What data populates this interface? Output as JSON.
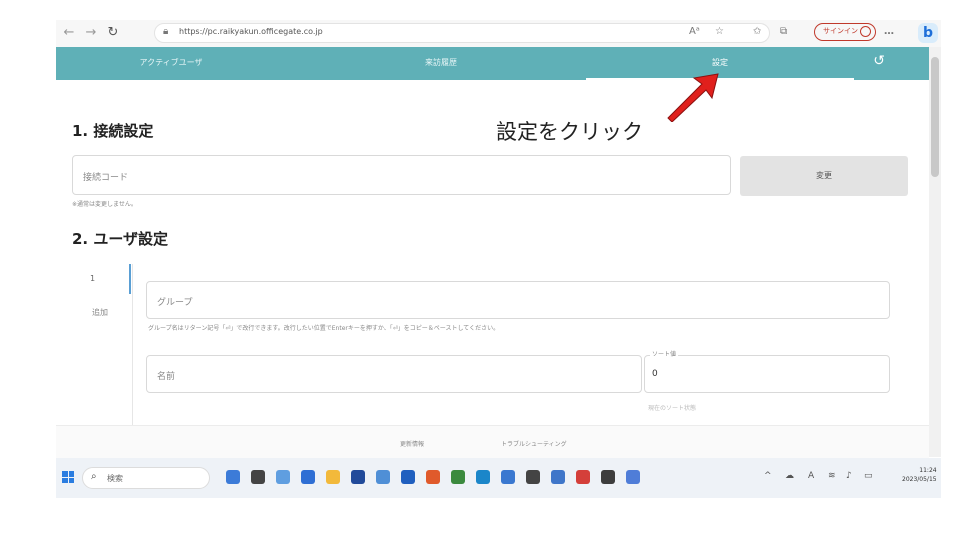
{
  "browser": {
    "url": "https://pc.raikyakun.officegate.co.jp",
    "signin_label": "サインイン",
    "more_label": "…"
  },
  "nav": {
    "tabs": [
      "アクティブユーザ",
      "来訪履歴",
      "設定"
    ],
    "active_tab": "設定"
  },
  "section1": {
    "title": "1. 接続設定",
    "connection_placeholder": "接続コード",
    "change_button": "変更",
    "note": "※通常は変更しません。"
  },
  "annotation": {
    "text": "設定をクリック",
    "arrow_color": "#e0201c"
  },
  "section2": {
    "title": "2. ユーザ設定",
    "tab_number": "1",
    "tab_add": "追加",
    "group_placeholder": "グループ",
    "group_help": "グループ名はリターン記号「⏎」で改行できます。改行したい位置でEnterキーを押すか、「⏎」をコピー＆ペーストしてください。",
    "name_placeholder": "名前",
    "sort_label": "ソート値",
    "sort_value": "0",
    "sort_current": "現在のソート状態"
  },
  "footer": {
    "links": [
      "更新情報",
      "トラブルシューティング"
    ]
  },
  "taskbar": {
    "search_label": "検索",
    "time": "11:24",
    "date": "2023/05/15",
    "app_colors": [
      "#3c7bd8",
      "#444444",
      "#5f9ee0",
      "#2f6fd4",
      "#f2b93b",
      "#214a9a",
      "#4f8fd6",
      "#1f5fbf",
      "#e05a2b",
      "#3b8a3e",
      "#1b86c9",
      "#3a78d0",
      "#444444",
      "#3f76c9",
      "#d43f3a",
      "#3d3d3d",
      "#4f7dd8"
    ]
  },
  "colors": {
    "nav_bg": "#5fb0b7",
    "accent": "#1e6fd9"
  }
}
